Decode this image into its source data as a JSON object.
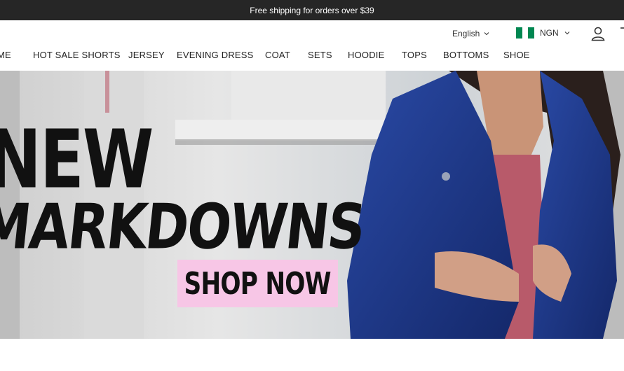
{
  "announcement": "Free shipping for orders over $39",
  "utility": {
    "language": "English",
    "currency": "NGN",
    "flag_colors": [
      "#008751",
      "#ffffff",
      "#008751"
    ]
  },
  "nav": {
    "items": [
      "ME",
      "HOT SALE SHORTS",
      "JERSEY",
      "EVENING DRESS",
      "COAT",
      "SETS",
      "HOODIE",
      "TOPS",
      "BOTTOMS",
      "SHOE"
    ]
  },
  "hero": {
    "headline_1": "NEW",
    "headline_2": "MARKDOWNS",
    "cta": "SHOP NOW",
    "cta_color": "#f7c6e6",
    "jacket_color": "#1f3a8c"
  }
}
